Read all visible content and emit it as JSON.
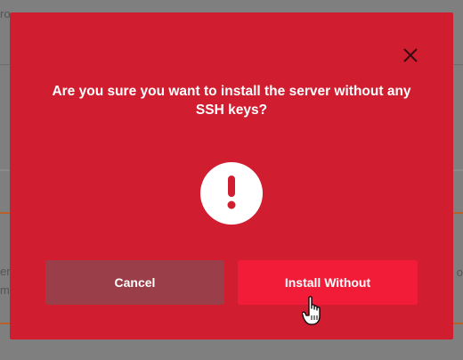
{
  "dialog": {
    "title": "Are you sure you want to install the server without any SSH keys?",
    "close_icon": "close-icon",
    "alert_icon": "exclamation-circle-icon",
    "cancel_label": "Cancel",
    "confirm_label": "Install Without"
  },
  "background": {
    "fragment_top": "ro",
    "fragment_left_1": "erv",
    "fragment_left_2": "m",
    "fragment_right": "o"
  },
  "colors": {
    "modal_bg": "#d11d30",
    "cancel_bg": "#9a3f49",
    "confirm_bg": "#f21c39",
    "overlay": "#7f7f7f"
  }
}
